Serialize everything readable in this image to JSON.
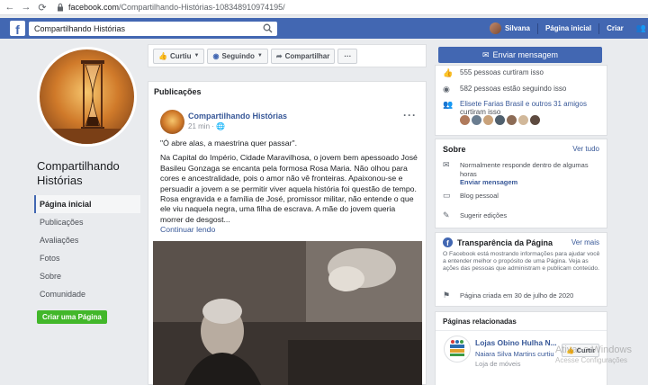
{
  "browser": {
    "url_prefix": "facebook.com",
    "url_path": "/Compartilhando-Histórias-108348910974195/"
  },
  "topbar": {
    "search_value": "Compartilhando Histórias",
    "user_name": "Silvana",
    "home_label": "Página inicial",
    "create_label": "Criar"
  },
  "page": {
    "name": "Compartilhando Histórias"
  },
  "left_nav": {
    "items": [
      {
        "label": "Página inicial"
      },
      {
        "label": "Publicações"
      },
      {
        "label": "Avaliações"
      },
      {
        "label": "Fotos"
      },
      {
        "label": "Sobre"
      },
      {
        "label": "Comunidade"
      }
    ],
    "create_page_label": "Criar uma Página"
  },
  "actions": {
    "like": "Curtiu",
    "follow": "Seguindo",
    "share": "Compartilhar",
    "more": "···"
  },
  "posts": {
    "header": "Publicações",
    "author": "Compartilhando Histórias",
    "time": "21 min",
    "more": "···",
    "quote": "\"Ó abre alas, a maestrina quer passar\".",
    "body": "Na Capital do Império, Cidade Maravilhosa, o jovem bem apessoado José Basileu Gonzaga se encanta pela formosa Rosa Maria. Não olhou para cores e ancestralidade, pois o amor não vê fronteiras. Apaixonou-se e persuadir a jovem a se permitir viver aquela história foi questão de tempo. Rosa engravida e a família de José, promissor militar, não entende o que ele viu naquela negra, uma filha de escrava. A mãe do jovem queria morrer de desgost...",
    "continue": "Continuar lendo"
  },
  "right": {
    "message_button": "Enviar mensagem",
    "likes_count": "555 pessoas curtiram isso",
    "follows_count": "582 pessoas estão seguindo isso",
    "friends_names": "Elisete Farias Brasil e outros 31 amigos",
    "friends_suffix": "curtiram isso",
    "about": {
      "title": "Sobre",
      "see_all": "Ver tudo",
      "response": "Normalmente responde dentro de algumas horas",
      "send_message": "Enviar mensagem",
      "blog": "Blog pessoal",
      "suggest": "Sugerir edições"
    },
    "transparency": {
      "title": "Transparência da Página",
      "see_more": "Ver mais",
      "text": "O Facebook está mostrando informações para ajudar você a entender melhor o propósito de uma Página. Veja as ações das pessoas que administram e publicam conteúdo.",
      "created": "Página criada em 30 de julho de 2020"
    },
    "related": {
      "title": "Páginas relacionadas",
      "name": "Lojas Obino Hulha N...",
      "sub_name": "Naiara Silva Martins curtiu",
      "category": "Loja de móveis",
      "like_button": "Curtir"
    }
  },
  "watermark": {
    "line1": "Ativar o Windows",
    "line2": "Acesse Configurações"
  },
  "colors": {
    "fb_blue": "#4267b2",
    "link": "#385898",
    "green": "#42b72a"
  }
}
